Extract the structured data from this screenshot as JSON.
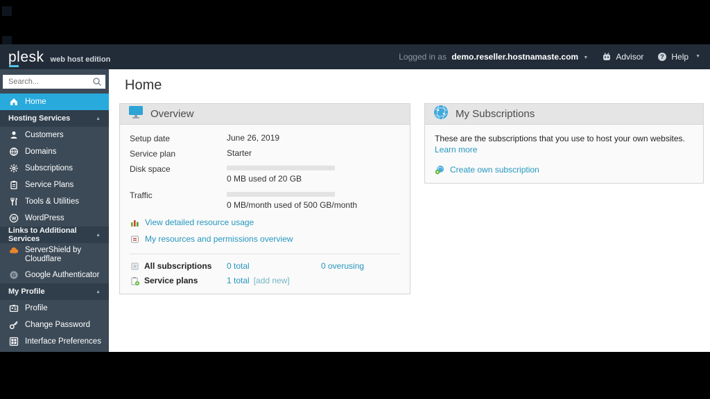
{
  "header": {
    "logo": "plesk",
    "edition": "web host edition",
    "logged_in_prefix": "Logged in as",
    "account": "demo.reseller.hostnamaste.com",
    "advisor_label": "Advisor",
    "help_label": "Help",
    "help_glyph": "?"
  },
  "sidebar": {
    "search_placeholder": "Search...",
    "sections": [
      {
        "label": "Hosting Services"
      },
      {
        "label": "Links to Additional Services"
      },
      {
        "label": "My Profile"
      }
    ],
    "items": [
      {
        "label": "Home"
      },
      {
        "label": "Customers"
      },
      {
        "label": "Domains"
      },
      {
        "label": "Subscriptions"
      },
      {
        "label": "Service Plans"
      },
      {
        "label": "Tools & Utilities"
      },
      {
        "label": "WordPress"
      },
      {
        "label": "ServerShield by Cloudflare"
      },
      {
        "label": "Google Authenticator"
      },
      {
        "label": "Profile"
      },
      {
        "label": "Change Password"
      },
      {
        "label": "Interface Preferences"
      }
    ]
  },
  "main": {
    "page_title": "Home",
    "overview": {
      "title": "Overview",
      "rows": [
        {
          "label": "Setup date",
          "value": "June 26, 2019"
        },
        {
          "label": "Service plan",
          "value": "Starter"
        },
        {
          "label": "Disk space",
          "usage": "0 MB used of 20 GB"
        },
        {
          "label": "Traffic",
          "usage": "0 MB/month used of 500 GB/month"
        }
      ],
      "links": [
        {
          "label": "View detailed resource usage"
        },
        {
          "label": "My resources and permissions overview"
        }
      ],
      "summary": [
        {
          "label": "All subscriptions",
          "total": "0 total",
          "extra": "0 overusing"
        },
        {
          "label": "Service plans",
          "total": "1 total",
          "extra": "[add new]"
        }
      ]
    },
    "subscriptions": {
      "title": "My Subscriptions",
      "description": "These are the subscriptions that you use to host your own websites.",
      "learn_more": "Learn more",
      "create_label": "Create own subscription"
    }
  },
  "colors": {
    "accent_blue": "#28aadc",
    "link_blue": "#2596be",
    "header_bg": "#222c38",
    "sidebar_bg": "#3c4a57",
    "section_bg": "#303d4a",
    "panel_header_bg": "#e5e5e5",
    "servershield_orange": "#e8862d",
    "icon_green": "#5cb52c"
  }
}
